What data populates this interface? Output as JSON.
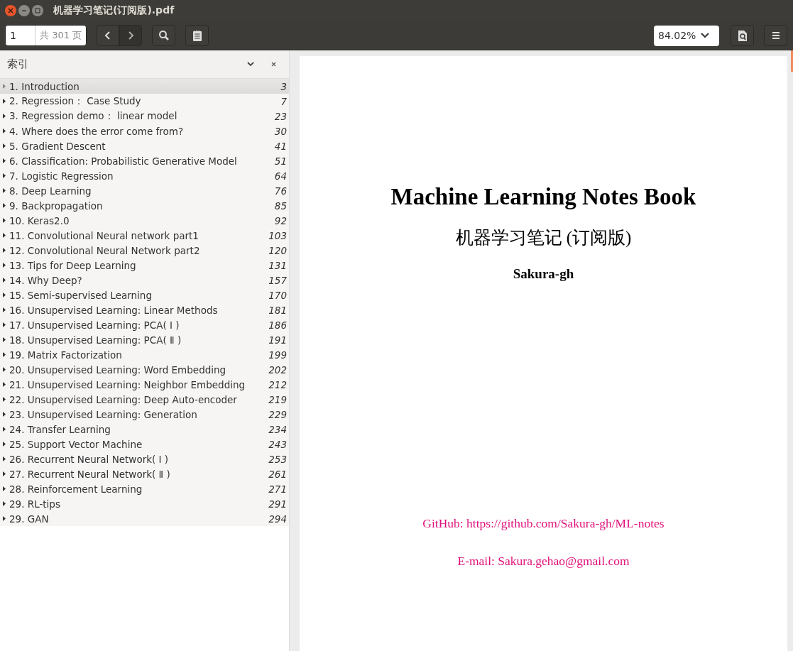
{
  "window": {
    "title": "机器学习笔记(订阅版).pdf"
  },
  "toolbar": {
    "page_field": {
      "value": "1",
      "total": "共 301 页"
    },
    "zoom": {
      "value": "84.02%"
    }
  },
  "sidebar": {
    "title": "索引",
    "items": [
      {
        "label": "1. Introduction",
        "page": "3",
        "selected": true
      },
      {
        "label": "2. Regression： Case Study",
        "page": "7",
        "selected": false
      },
      {
        "label": "3. Regression demo： linear model",
        "page": "23",
        "selected": false
      },
      {
        "label": "4. Where does the error come from?",
        "page": "30",
        "selected": false
      },
      {
        "label": "5. Gradient Descent",
        "page": "41",
        "selected": false
      },
      {
        "label": "6. Classification: Probabilistic Generative Model",
        "page": "51",
        "selected": false
      },
      {
        "label": "7. Logistic Regression",
        "page": "64",
        "selected": false
      },
      {
        "label": "8. Deep Learning",
        "page": "76",
        "selected": false
      },
      {
        "label": "9. Backpropagation",
        "page": "85",
        "selected": false
      },
      {
        "label": "10. Keras2.0",
        "page": "92",
        "selected": false
      },
      {
        "label": "11. Convolutional Neural network part1",
        "page": "103",
        "selected": false
      },
      {
        "label": "12. Convolutional Neural Network part2",
        "page": "120",
        "selected": false
      },
      {
        "label": "13. Tips for Deep Learning",
        "page": "131",
        "selected": false
      },
      {
        "label": "14. Why Deep?",
        "page": "157",
        "selected": false
      },
      {
        "label": "15. Semi-supervised Learning",
        "page": "170",
        "selected": false
      },
      {
        "label": "16. Unsupervised Learning: Linear Methods",
        "page": "181",
        "selected": false
      },
      {
        "label": "17. Unsupervised Learning: PCA( Ⅰ )",
        "page": "186",
        "selected": false
      },
      {
        "label": "18. Unsupervised Learning: PCA( Ⅱ )",
        "page": "191",
        "selected": false
      },
      {
        "label": "19. Matrix Factorization",
        "page": "199",
        "selected": false
      },
      {
        "label": "20. Unsupervised Learning: Word Embedding",
        "page": "202",
        "selected": false
      },
      {
        "label": "21. Unsupervised Learning: Neighbor Embedding",
        "page": "212",
        "selected": false
      },
      {
        "label": "22. Unsupervised Learning: Deep Auto-encoder",
        "page": "219",
        "selected": false
      },
      {
        "label": "23. Unsupervised Learning: Generation",
        "page": "229",
        "selected": false
      },
      {
        "label": "24. Transfer Learning",
        "page": "234",
        "selected": false
      },
      {
        "label": "25. Support Vector Machine",
        "page": "243",
        "selected": false
      },
      {
        "label": "26. Recurrent Neural Network( Ⅰ )",
        "page": "253",
        "selected": false
      },
      {
        "label": "27. Recurrent Neural Network( Ⅱ )",
        "page": "261",
        "selected": false
      },
      {
        "label": "28. Reinforcement Learning",
        "page": "271",
        "selected": false
      },
      {
        "label": "29. RL-tips",
        "page": "291",
        "selected": false
      },
      {
        "label": "29. GAN",
        "page": "294",
        "selected": false
      }
    ]
  },
  "document": {
    "title": "Machine Learning Notes Book",
    "subtitle": "机器学习笔记 (订阅版)",
    "author": "Sakura-gh",
    "github": "GitHub: https://github.com/Sakura-gh/ML-notes",
    "email": "E-mail: Sakura.gehao@gmail.com"
  }
}
